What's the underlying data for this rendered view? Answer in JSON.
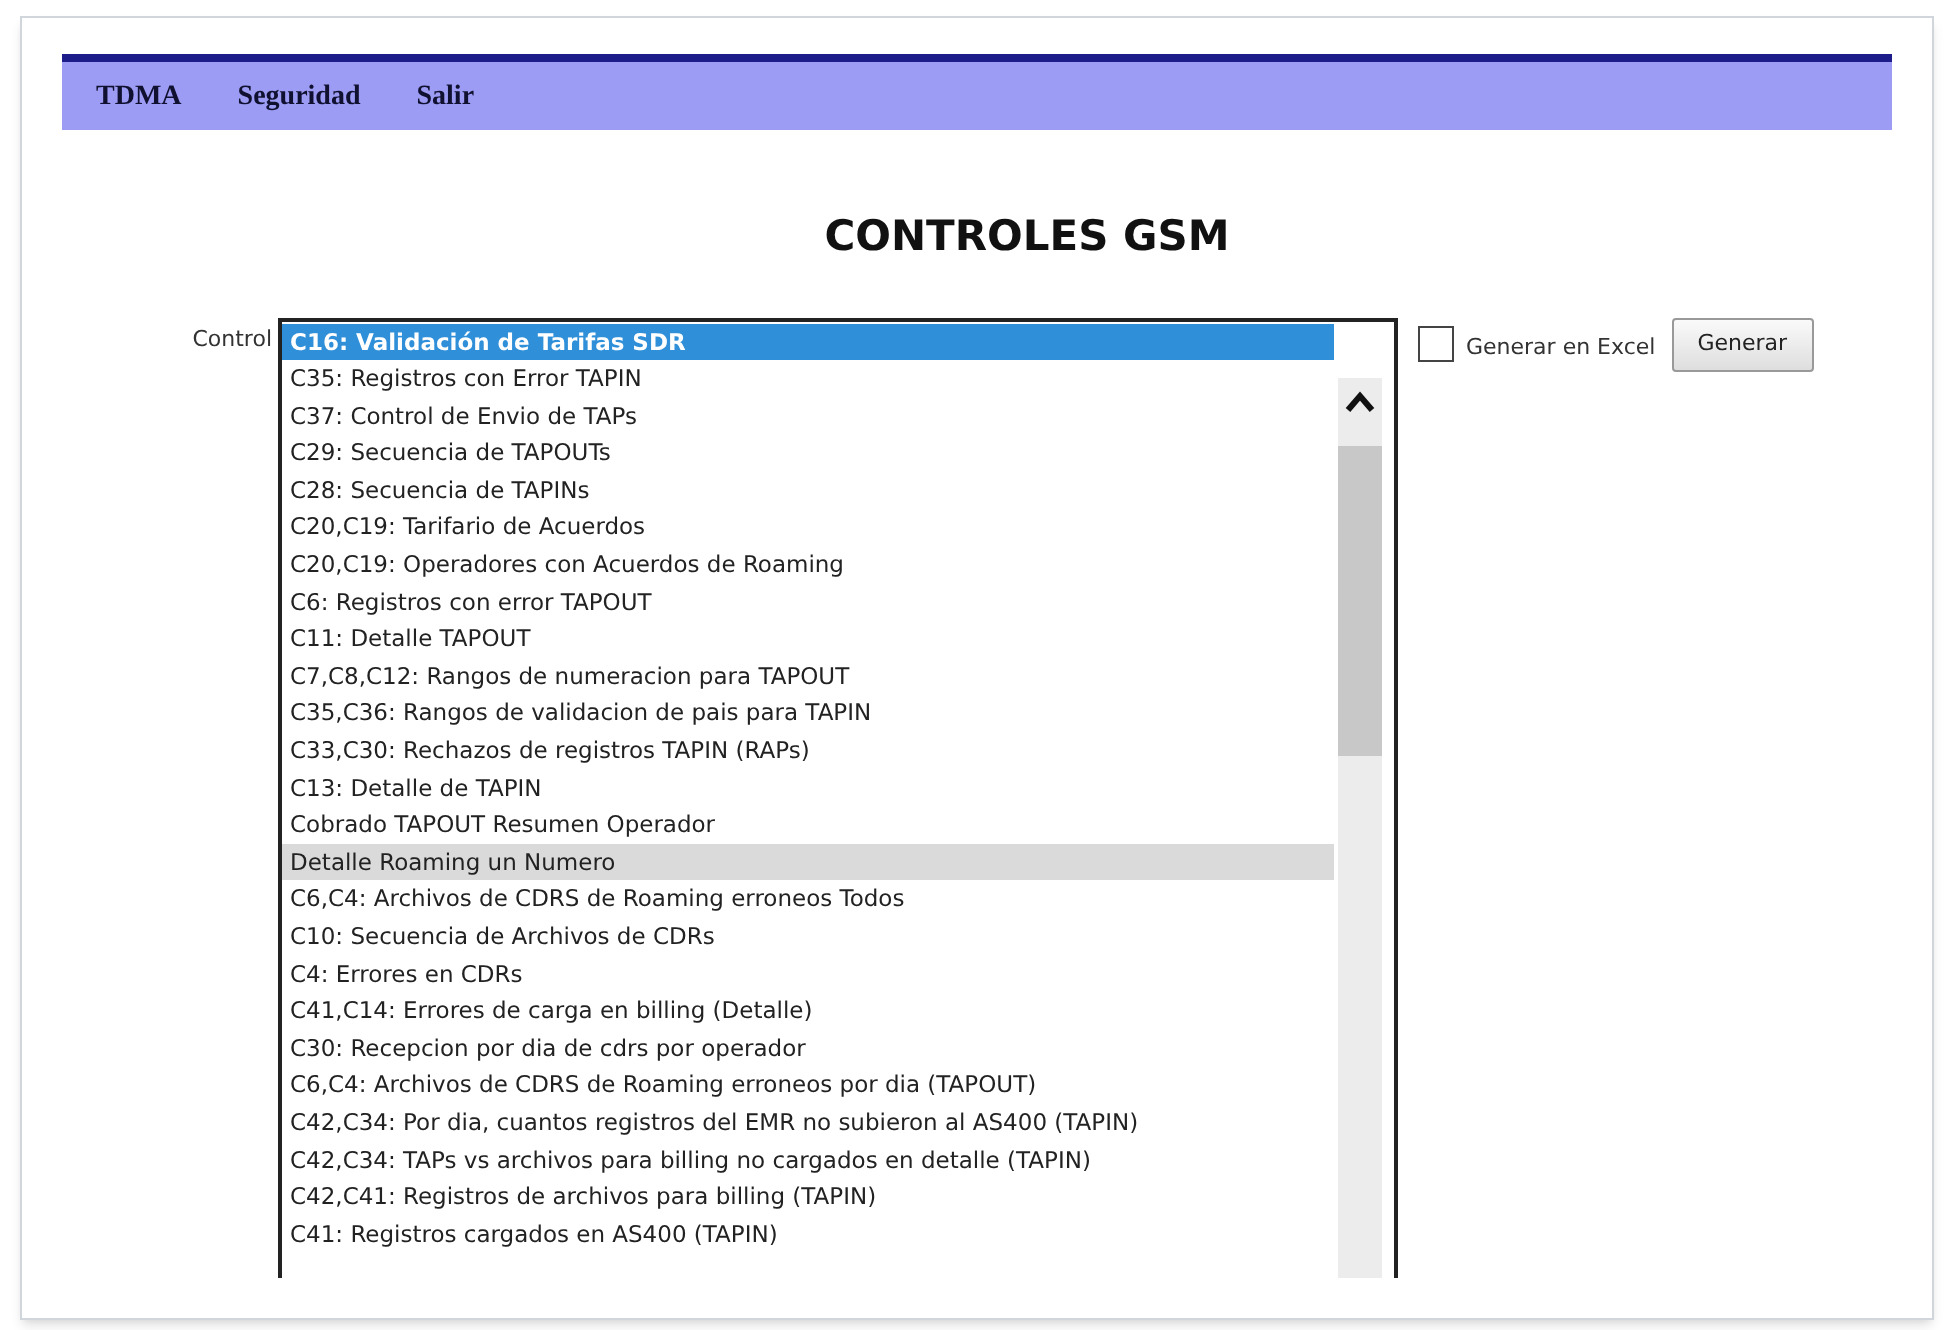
{
  "menu": [
    {
      "label": "TDMA"
    },
    {
      "label": "Seguridad"
    },
    {
      "label": "Salir"
    }
  ],
  "title": "CONTROLES GSM",
  "control_label": "Control",
  "list": {
    "items": [
      {
        "label": "C16: Validación de Tarifas SDR",
        "selected": true,
        "hovered": false
      },
      {
        "label": "C35: Registros con Error TAPIN",
        "selected": false,
        "hovered": false
      },
      {
        "label": "C37: Control de Envio de TAPs",
        "selected": false,
        "hovered": false
      },
      {
        "label": "C29: Secuencia de TAPOUTs",
        "selected": false,
        "hovered": false
      },
      {
        "label": "C28: Secuencia de TAPINs",
        "selected": false,
        "hovered": false
      },
      {
        "label": "C20,C19: Tarifario de Acuerdos",
        "selected": false,
        "hovered": false
      },
      {
        "label": "C20,C19: Operadores con Acuerdos de Roaming",
        "selected": false,
        "hovered": false
      },
      {
        "label": "C6: Registros con error TAPOUT",
        "selected": false,
        "hovered": false
      },
      {
        "label": "C11: Detalle TAPOUT",
        "selected": false,
        "hovered": false
      },
      {
        "label": "C7,C8,C12: Rangos de numeracion para TAPOUT",
        "selected": false,
        "hovered": false
      },
      {
        "label": "C35,C36: Rangos de validacion de pais para TAPIN",
        "selected": false,
        "hovered": false
      },
      {
        "label": "C33,C30: Rechazos de registros TAPIN (RAPs)",
        "selected": false,
        "hovered": false
      },
      {
        "label": "C13: Detalle de TAPIN",
        "selected": false,
        "hovered": false
      },
      {
        "label": "Cobrado TAPOUT Resumen Operador",
        "selected": false,
        "hovered": false
      },
      {
        "label": "Detalle Roaming un Numero",
        "selected": false,
        "hovered": true
      },
      {
        "label": "C6,C4: Archivos de CDRS de Roaming erroneos Todos",
        "selected": false,
        "hovered": false
      },
      {
        "label": "C10: Secuencia de Archivos de CDRs",
        "selected": false,
        "hovered": false
      },
      {
        "label": "C4: Errores en CDRs",
        "selected": false,
        "hovered": false
      },
      {
        "label": "C41,C14: Errores de carga en billing (Detalle)",
        "selected": false,
        "hovered": false
      },
      {
        "label": "C30: Recepcion por dia de cdrs por operador",
        "selected": false,
        "hovered": false
      },
      {
        "label": "C6,C4: Archivos de CDRS de Roaming erroneos por dia (TAPOUT)",
        "selected": false,
        "hovered": false
      },
      {
        "label": "C42,C34: Por dia, cuantos registros del EMR no subieron al AS400 (TAPIN)",
        "selected": false,
        "hovered": false
      },
      {
        "label": "C42,C34: TAPs vs archivos para billing no cargados en detalle (TAPIN)",
        "selected": false,
        "hovered": false
      },
      {
        "label": "C42,C41: Registros de archivos para billing (TAPIN)",
        "selected": false,
        "hovered": false
      },
      {
        "label": "C41: Registros cargados en AS400 (TAPIN)",
        "selected": false,
        "hovered": false
      }
    ]
  },
  "excel": {
    "label": "Generar en Excel",
    "checked": false
  },
  "generate_button": "Generar"
}
